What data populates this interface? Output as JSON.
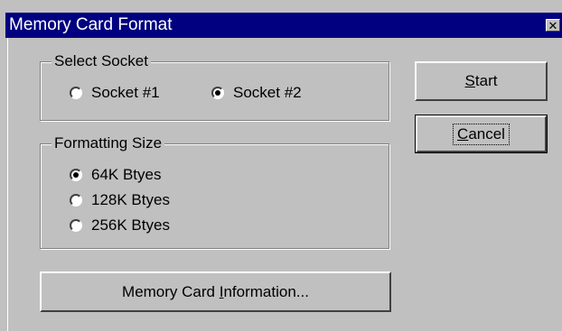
{
  "window": {
    "title": "Memory Card Format",
    "close_glyph": "✕"
  },
  "socket_group": {
    "legend": "Select Socket",
    "options": [
      {
        "label": "Socket #1",
        "selected": false
      },
      {
        "label": "Socket #2",
        "selected": true
      }
    ]
  },
  "size_group": {
    "legend": "Formatting Size",
    "options": [
      {
        "label": "64K Btyes",
        "selected": true
      },
      {
        "label": "128K Btyes",
        "selected": false
      },
      {
        "label": "256K Btyes",
        "selected": false
      }
    ]
  },
  "buttons": {
    "start": {
      "mnemonic": "S",
      "rest": "tart"
    },
    "cancel": {
      "mnemonic": "C",
      "rest": "ancel"
    },
    "info": {
      "before": "Memory Card ",
      "mnemonic": "I",
      "rest": "nformation..."
    }
  },
  "colors": {
    "face": "#c0c0c0",
    "titlebar": "#000080"
  }
}
